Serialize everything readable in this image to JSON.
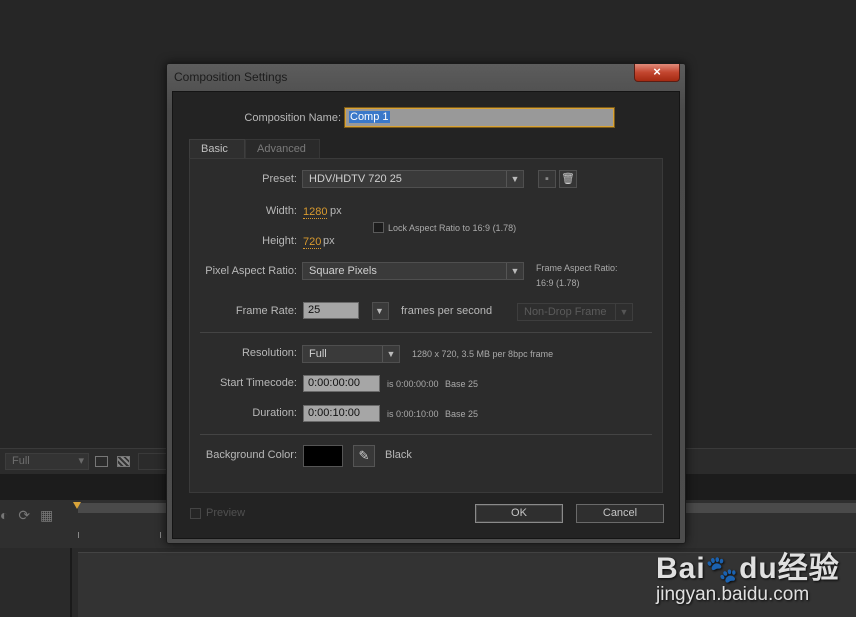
{
  "background": {
    "resolution_value": "Full"
  },
  "dialog": {
    "title": "Composition Settings",
    "close_glyph": "×",
    "comp_name_label": "Composition Name:",
    "comp_name_value": "Comp 1",
    "tabs": [
      {
        "label": "Basic",
        "active": true
      },
      {
        "label": "Advanced",
        "active": false
      }
    ],
    "preset_label": "Preset:",
    "preset_value": "HDV/HDTV 720 25",
    "width_label": "Width:",
    "width_value": "1280",
    "width_unit": "px",
    "height_label": "Height:",
    "height_value": "720",
    "height_unit": "px",
    "lock_aspect_label": "Lock Aspect Ratio to 16:9 (1.78)",
    "par_label": "Pixel Aspect Ratio:",
    "par_value": "Square Pixels",
    "frame_aspect_label": "Frame Aspect Ratio:",
    "frame_aspect_value": "16:9 (1.78)",
    "frame_rate_label": "Frame Rate:",
    "frame_rate_value": "25",
    "frames_per_second": "frames per second",
    "drop_frame_value": "Non-Drop Frame",
    "resolution_label": "Resolution:",
    "resolution_value": "Full",
    "resolution_info": "1280 x 720, 3.5 MB per 8bpc frame",
    "start_tc_label": "Start Timecode:",
    "start_tc_value": "0:00:00:00",
    "start_tc_info": "is 0:00:00:00",
    "start_tc_base": "Base 25",
    "duration_label": "Duration:",
    "duration_value": "0:00:10:00",
    "duration_info": "is 0:00:10:00",
    "duration_base": "Base 25",
    "bg_color_label": "Background Color:",
    "bg_color_name": "Black",
    "bg_color_hex": "#000000",
    "preview_label": "Preview",
    "ok_label": "OK",
    "cancel_label": "Cancel"
  },
  "watermark": {
    "brand_text": "Bai",
    "brand_text2": "du",
    "brand_cn": "经验",
    "url": "jingyan.baidu.com"
  }
}
